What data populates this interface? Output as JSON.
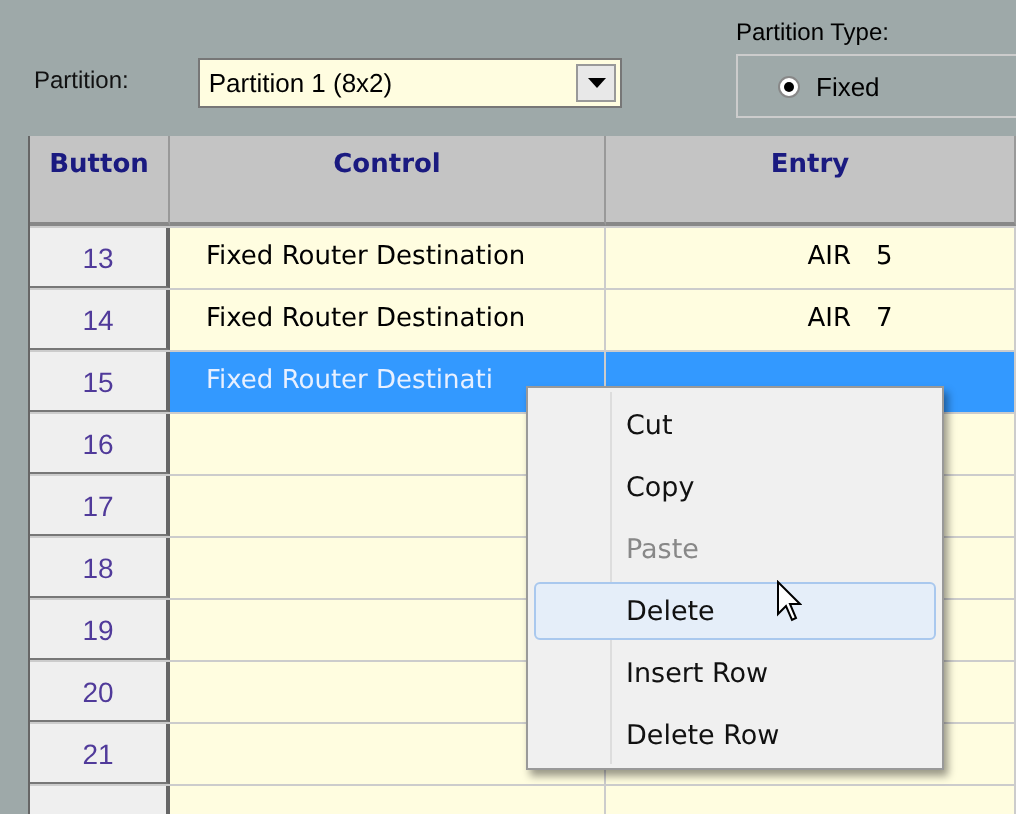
{
  "partition": {
    "label": "Partition:",
    "value": "Partition 1 (8x2)"
  },
  "partition_type": {
    "label": "Partition Type:",
    "options": [
      {
        "label": "Fixed",
        "selected": true
      }
    ]
  },
  "table": {
    "columns": [
      "Button",
      "Control",
      "Entry"
    ],
    "rows": [
      {
        "button": "13",
        "control": "Fixed Router Destination",
        "entry": "AIR   5",
        "selected": false
      },
      {
        "button": "14",
        "control": "Fixed Router Destination",
        "entry": "AIR   7",
        "selected": false
      },
      {
        "button": "15",
        "control": "Fixed Router Destinati",
        "selected": true
      },
      {
        "button": "16",
        "selected": false
      },
      {
        "button": "17",
        "selected": false
      },
      {
        "button": "18",
        "selected": false
      },
      {
        "button": "19",
        "selected": false
      },
      {
        "button": "20",
        "selected": false
      },
      {
        "button": "21",
        "selected": false
      },
      {
        "selected": false
      }
    ]
  },
  "context_menu": [
    {
      "label": "Cut",
      "disabled": false,
      "selected": false
    },
    {
      "label": "Copy",
      "disabled": false,
      "selected": false
    },
    {
      "label": "Paste",
      "disabled": true,
      "selected": false
    },
    {
      "label": "Delete",
      "disabled": false,
      "selected": true
    },
    {
      "label": "Insert Row",
      "disabled": false,
      "selected": false
    },
    {
      "label": "Delete Row",
      "disabled": false,
      "selected": false
    }
  ]
}
